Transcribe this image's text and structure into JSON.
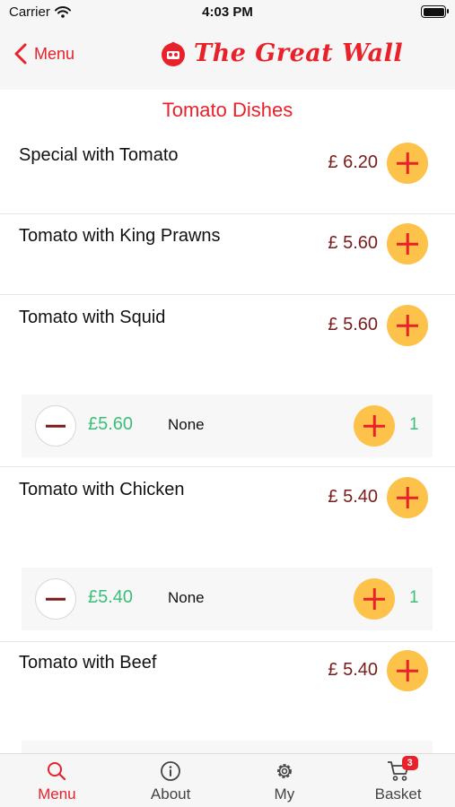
{
  "status": {
    "carrier": "Carrier",
    "time": "4:03 PM"
  },
  "nav": {
    "back_label": "Menu",
    "brand": "The Great Wall"
  },
  "section": {
    "title": "Tomato Dishes"
  },
  "dishes": [
    {
      "name": "Special with Tomato",
      "price": "£ 6.20"
    },
    {
      "name": "Tomato with King Prawns",
      "price": "£ 5.60"
    },
    {
      "name": "Tomato with Squid",
      "price": "£ 5.60",
      "selection": {
        "price": "£5.60",
        "option": "None",
        "count": "1"
      }
    },
    {
      "name": "Tomato with Chicken",
      "price": "£ 5.40",
      "selection": {
        "price": "£5.40",
        "option": "None",
        "count": "1"
      }
    },
    {
      "name": "Tomato with Beef",
      "price": "£ 5.40"
    }
  ],
  "tabs": [
    {
      "label": "Menu",
      "icon": "search-icon",
      "active": true
    },
    {
      "label": "About",
      "icon": "info-icon"
    },
    {
      "label": "My",
      "icon": "gear-icon"
    },
    {
      "label": "Basket",
      "icon": "cart-icon",
      "badge": "3"
    }
  ],
  "colors": {
    "accent": "#e8212a",
    "add_button": "#fcc24a",
    "price": "#7a1b1b",
    "selected_price": "#3bbf78"
  }
}
